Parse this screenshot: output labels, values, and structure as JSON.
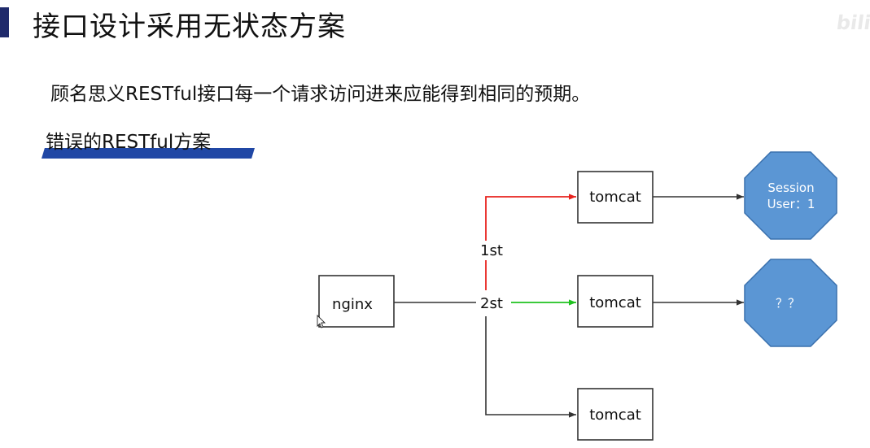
{
  "slide": {
    "title": "接口设计采用无状态方案",
    "watermark": "bili",
    "subtitle": "顾名思义RESTful接口每一个请求访问进来应能得到相同的预期。",
    "section_label": "错误的RESTful方案"
  },
  "diagram": {
    "nodes": {
      "nginx": "nginx",
      "tomcat_1": "tomcat",
      "tomcat_2": "tomcat",
      "tomcat_3": "tomcat"
    },
    "edge_labels": {
      "first": "1st",
      "second": "2st"
    },
    "session_1": {
      "line1": "Session",
      "line2": "User：1"
    },
    "session_2": {
      "line1": "？？"
    },
    "colors": {
      "first_request": "#e8231e",
      "second_request": "#1fc21f",
      "line": "#333333",
      "octagon_fill": "#5b96d4",
      "octagon_stroke": "#3a70ad"
    }
  }
}
